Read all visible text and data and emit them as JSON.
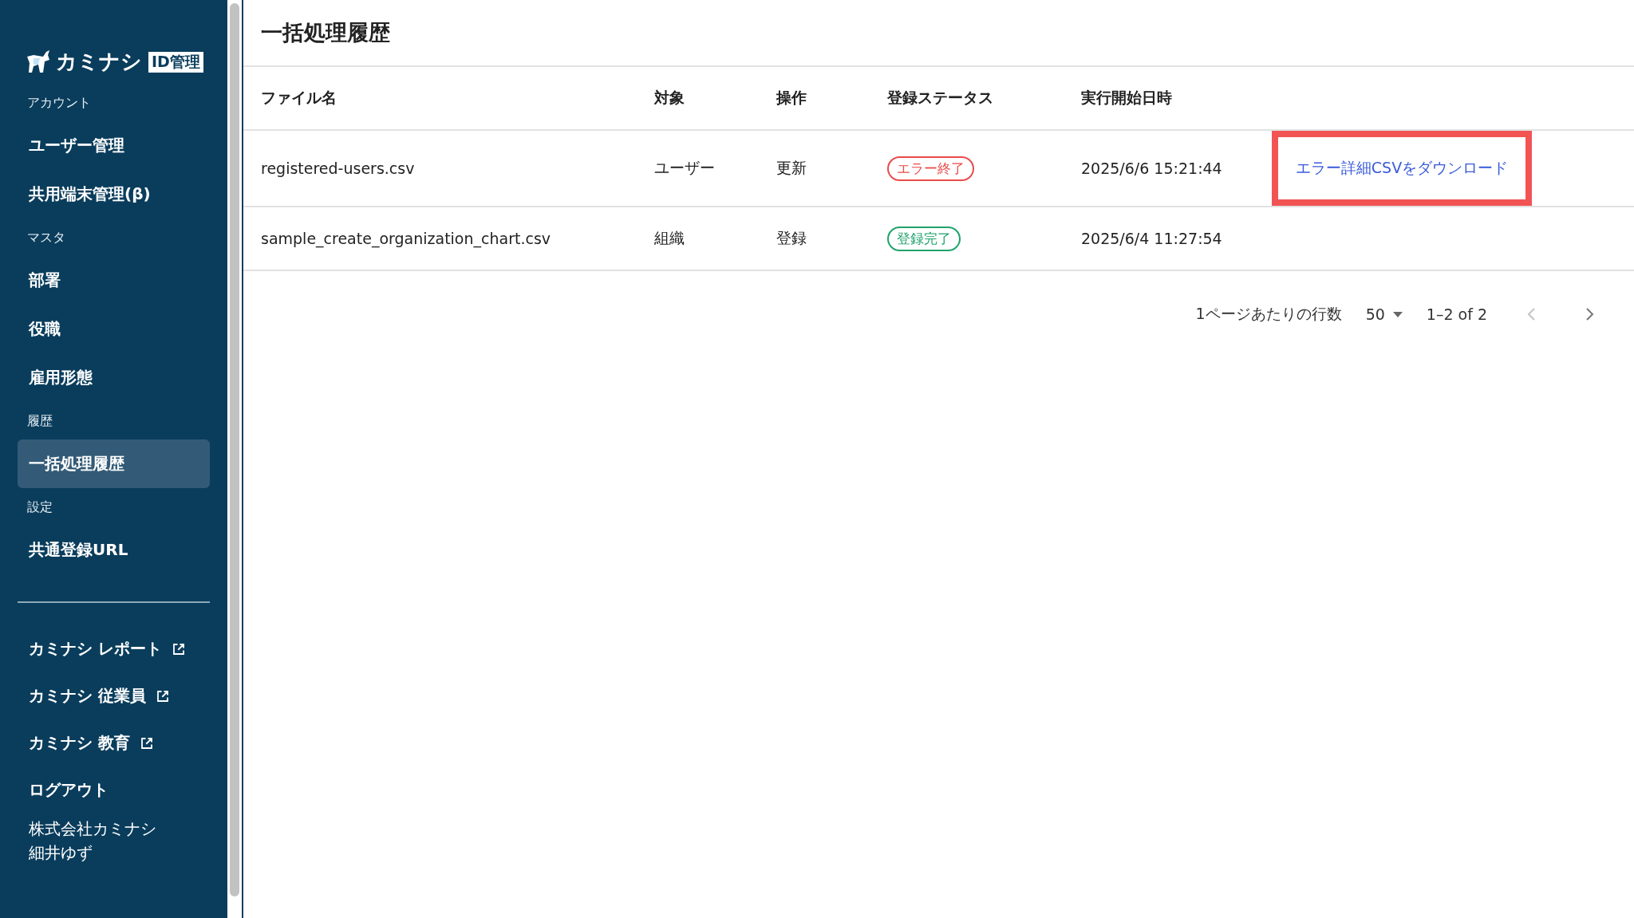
{
  "sidebar": {
    "logo": {
      "wordmark": "カミナシ",
      "badge": "ID管理"
    },
    "sections": [
      {
        "heading": "アカウント",
        "items": [
          {
            "label": "ユーザー管理",
            "selected": false
          },
          {
            "label": "共用端末管理(β)",
            "selected": false
          }
        ]
      },
      {
        "heading": "マスタ",
        "items": [
          {
            "label": "部署",
            "selected": false
          },
          {
            "label": "役職",
            "selected": false
          },
          {
            "label": "雇用形態",
            "selected": false
          }
        ]
      },
      {
        "heading": "履歴",
        "items": [
          {
            "label": "一括処理履歴",
            "selected": true
          }
        ]
      },
      {
        "heading": "設定",
        "items": [
          {
            "label": "共通登録URL",
            "selected": false
          }
        ]
      }
    ],
    "links": [
      {
        "label": "カミナシ レポート",
        "external": true
      },
      {
        "label": "カミナシ 従業員",
        "external": true
      },
      {
        "label": "カミナシ 教育",
        "external": true
      },
      {
        "label": "ログアウト",
        "external": false
      }
    ],
    "account": {
      "company": "株式会社カミナシ",
      "user": "細井ゆず"
    }
  },
  "page": {
    "title": "一括処理履歴"
  },
  "table": {
    "columns": [
      "ファイル名",
      "対象",
      "操作",
      "登録ステータス",
      "実行開始日時"
    ],
    "rows": [
      {
        "file": "registered-users.csv",
        "target": "ユーザー",
        "operation": "更新",
        "status": {
          "label": "エラー終了",
          "kind": "error"
        },
        "started": "2025/6/6 15:21:44",
        "action": {
          "label": "エラー詳細CSVをダウンロード",
          "highlighted": true
        }
      },
      {
        "file": "sample_create_organization_chart.csv",
        "target": "組織",
        "operation": "登録",
        "status": {
          "label": "登録完了",
          "kind": "success"
        },
        "started": "2025/6/4 11:27:54"
      }
    ]
  },
  "pagination": {
    "rows_per_page_label": "1ページあたりの行数",
    "rows_per_page": "50",
    "range": "1–2 of 2",
    "prev_disabled": true,
    "next_disabled": false
  }
}
